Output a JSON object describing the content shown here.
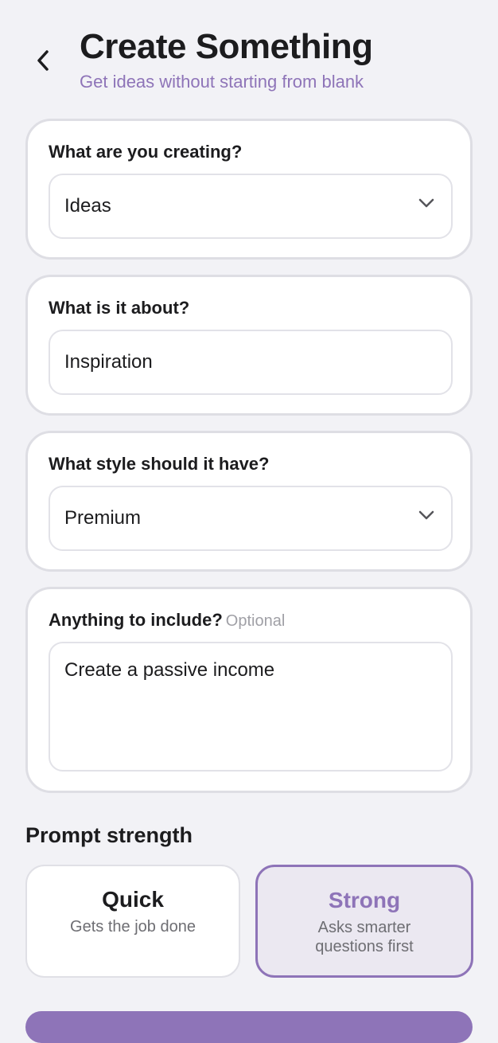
{
  "header": {
    "title": "Create Something",
    "subtitle": "Get ideas without starting from blank"
  },
  "form": {
    "creating": {
      "label": "What are you creating?",
      "value": "Ideas"
    },
    "about": {
      "label": "What is it about?",
      "value": "Inspiration"
    },
    "style": {
      "label": "What style should it have?",
      "value": "Premium"
    },
    "include": {
      "label": "Anything to include?",
      "optional": "Optional",
      "value": "Create a passive income"
    }
  },
  "strength": {
    "title": "Prompt strength",
    "options": [
      {
        "title": "Quick",
        "desc": "Gets the job done"
      },
      {
        "title": "Strong",
        "desc": "Asks smarter questions first"
      }
    ],
    "selected": "Strong"
  },
  "colors": {
    "accent": "#8e74b8",
    "selected_bg": "#ebe8f1",
    "background": "#f2f2f6"
  },
  "icons": {
    "back": "chevron-left-icon",
    "dropdown": "chevron-down-icon"
  }
}
